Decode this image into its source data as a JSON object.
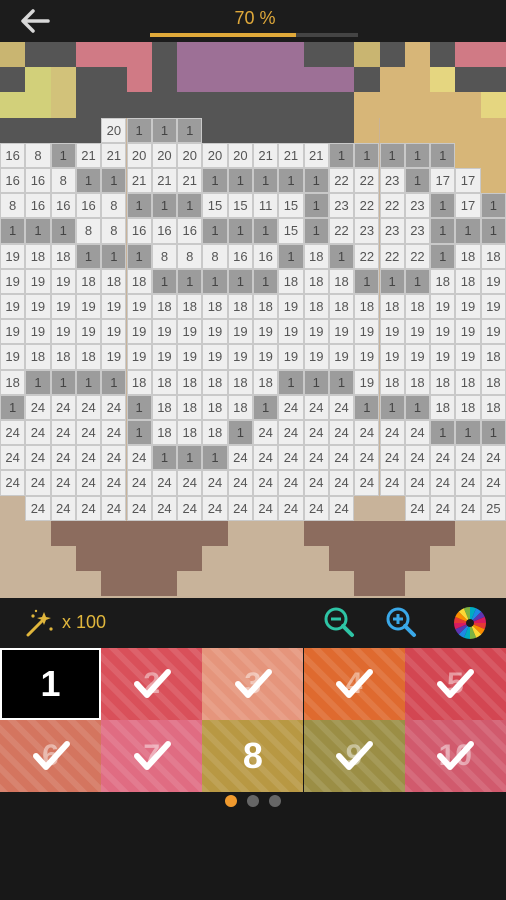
{
  "header": {
    "progress_label": "70 %",
    "progress": 0.7
  },
  "toolbar": {
    "hint_count": "x 100"
  },
  "palette": [
    {
      "number": "1",
      "color": "#000000",
      "done": false,
      "selected": true
    },
    {
      "number": "2",
      "color": "#d9505a",
      "done": true
    },
    {
      "number": "3",
      "color": "#e5957c",
      "done": true
    },
    {
      "number": "4",
      "color": "#df6a2f",
      "done": true
    },
    {
      "number": "5",
      "color": "#d34652",
      "done": true
    },
    {
      "number": "6",
      "color": "#d4755f",
      "done": true
    },
    {
      "number": "7",
      "color": "#e06c82",
      "done": true
    },
    {
      "number": "8",
      "color": "#b89843",
      "done": false
    },
    {
      "number": "9",
      "color": "#9b8e45",
      "done": true
    },
    {
      "number": "10",
      "color": "#d15a6d",
      "done": true
    }
  ],
  "pager": {
    "active": 0,
    "count": 3
  },
  "canvas": {
    "top_colors": [
      [
        "#c9b571",
        "#555555",
        "#555555",
        "#d07a85",
        "#d07a85",
        "#d07a85",
        "#555555",
        "#9d7096",
        "#9d7096",
        "#9d7096",
        "#9d7096",
        "#9d7096",
        "#555555",
        "#555555",
        "#c9b571",
        "#555555",
        "#d7b678",
        "#555555",
        "#d07a85",
        "#d07a85"
      ],
      [
        "#555555",
        "#d2d07a",
        "#d2c27a",
        "#555555",
        "#555555",
        "#d07a85",
        "#555555",
        "#9d7096",
        "#9d7096",
        "#9d7096",
        "#9d7096",
        "#9d7096",
        "#9d7096",
        "#9d7096",
        "#555555",
        "#d7b678",
        "#d7b678",
        "#e5d680",
        "#555555",
        "#555555"
      ],
      [
        "#d2d07a",
        "#d2d07a",
        "#d2c27a",
        "#555555",
        "#555555",
        "#555555",
        "#555555",
        "#555555",
        "#555555",
        "#555555",
        "#555555",
        "#555555",
        "#555555",
        "#555555",
        "#d7b678",
        "#d7b678",
        "#d7b678",
        "#d7b678",
        "#d7b678",
        "#e5d680"
      ]
    ],
    "grid_rows": [
      [
        "",
        "",
        "",
        "",
        "20",
        "1",
        "1",
        "1",
        "",
        "",
        "",
        "",
        "",
        "",
        "",
        "",
        "",
        "",
        "",
        ""
      ],
      [
        "16",
        "8",
        "1",
        "21",
        "21",
        "20",
        "20",
        "20",
        "20",
        "20",
        "21",
        "21",
        "21",
        "1",
        "1",
        "1",
        "1",
        "1",
        "",
        ""
      ],
      [
        "16",
        "16",
        "8",
        "1",
        "1",
        "21",
        "21",
        "21",
        "1",
        "1",
        "1",
        "1",
        "1",
        "22",
        "22",
        "23",
        "1",
        "17",
        "17",
        ""
      ],
      [
        "8",
        "16",
        "16",
        "16",
        "8",
        "1",
        "1",
        "1",
        "15",
        "15",
        "11",
        "15",
        "1",
        "23",
        "22",
        "22",
        "23",
        "1",
        "17",
        "1"
      ],
      [
        "1",
        "1",
        "1",
        "8",
        "8",
        "16",
        "16",
        "16",
        "1",
        "1",
        "1",
        "15",
        "1",
        "22",
        "23",
        "23",
        "23",
        "1",
        "1",
        "1"
      ],
      [
        "19",
        "18",
        "18",
        "1",
        "1",
        "1",
        "8",
        "8",
        "8",
        "16",
        "16",
        "1",
        "18",
        "1",
        "22",
        "22",
        "22",
        "1",
        "18",
        "18"
      ],
      [
        "19",
        "19",
        "19",
        "18",
        "18",
        "18",
        "1",
        "1",
        "1",
        "1",
        "1",
        "18",
        "18",
        "18",
        "1",
        "1",
        "1",
        "18",
        "18",
        "19"
      ],
      [
        "19",
        "19",
        "19",
        "19",
        "19",
        "19",
        "18",
        "18",
        "18",
        "18",
        "18",
        "19",
        "18",
        "18",
        "18",
        "18",
        "18",
        "19",
        "19",
        "19"
      ],
      [
        "19",
        "19",
        "19",
        "19",
        "19",
        "19",
        "19",
        "19",
        "19",
        "19",
        "19",
        "19",
        "19",
        "19",
        "19",
        "19",
        "19",
        "19",
        "19",
        "19"
      ],
      [
        "19",
        "18",
        "18",
        "18",
        "19",
        "19",
        "19",
        "19",
        "19",
        "19",
        "19",
        "19",
        "19",
        "19",
        "19",
        "19",
        "19",
        "19",
        "19",
        "18"
      ],
      [
        "18",
        "1",
        "1",
        "1",
        "1",
        "18",
        "18",
        "18",
        "18",
        "18",
        "18",
        "1",
        "1",
        "1",
        "19",
        "18",
        "18",
        "18",
        "18",
        "18"
      ],
      [
        "1",
        "24",
        "24",
        "24",
        "24",
        "1",
        "18",
        "18",
        "18",
        "18",
        "1",
        "24",
        "24",
        "24",
        "1",
        "1",
        "1",
        "18",
        "18",
        "18"
      ],
      [
        "24",
        "24",
        "24",
        "24",
        "24",
        "1",
        "18",
        "18",
        "18",
        "1",
        "24",
        "24",
        "24",
        "24",
        "24",
        "24",
        "24",
        "1",
        "1",
        "1"
      ],
      [
        "24",
        "24",
        "24",
        "24",
        "24",
        "24",
        "1",
        "1",
        "1",
        "24",
        "24",
        "24",
        "24",
        "24",
        "24",
        "24",
        "24",
        "24",
        "24",
        "24"
      ],
      [
        "24",
        "24",
        "24",
        "24",
        "24",
        "24",
        "24",
        "24",
        "24",
        "24",
        "24",
        "24",
        "24",
        "24",
        "24",
        "24",
        "24",
        "24",
        "24",
        "24"
      ],
      [
        "",
        "24",
        "24",
        "24",
        "24",
        "24",
        "24",
        "24",
        "24",
        "24",
        "24",
        "24",
        "24",
        "24",
        "",
        "",
        "24",
        "24",
        "24",
        "25"
      ]
    ]
  }
}
